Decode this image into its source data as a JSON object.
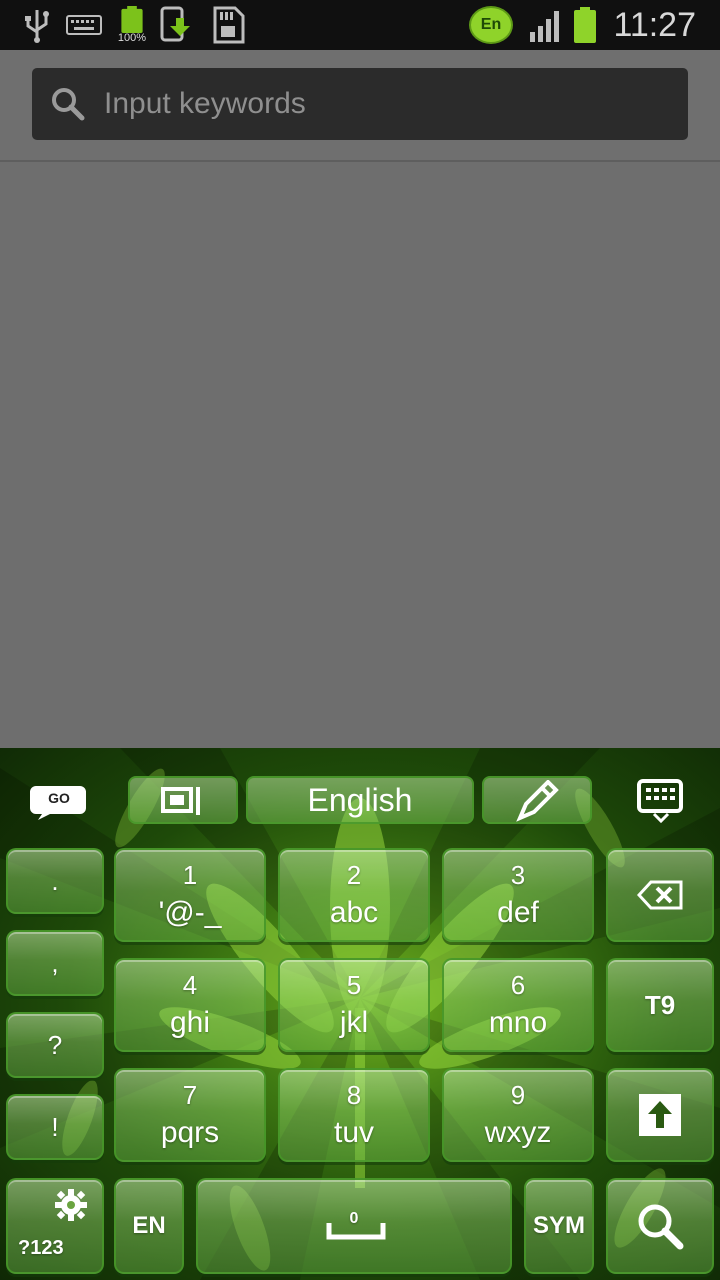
{
  "status_bar": {
    "battery_percent_label": "100%",
    "language_badge": "En",
    "time": "11:27",
    "icons": [
      "usb-icon",
      "keyboard-notification-icon",
      "battery-full-icon",
      "download-update-icon",
      "sd-card-icon",
      "language-badge-icon",
      "signal-icon",
      "battery-icon"
    ]
  },
  "search": {
    "placeholder": "Input keywords",
    "icon": "search-icon"
  },
  "keyboard": {
    "theme_colors": {
      "key_fill": "#a8dc80",
      "key_border": "#4a9628",
      "background": "#2a5a0e"
    },
    "toolbar": {
      "go_label": "GO",
      "language_label": "English",
      "icons": [
        "go-logo-icon",
        "resize-icon",
        "pen-icon",
        "keyboard-hide-icon"
      ]
    },
    "side_punct": [
      ".",
      ",",
      "?",
      "!"
    ],
    "keys": [
      {
        "num": "1",
        "letters": "'@-_"
      },
      {
        "num": "2",
        "letters": "abc"
      },
      {
        "num": "3",
        "letters": "def"
      },
      {
        "num": "4",
        "letters": "ghi"
      },
      {
        "num": "5",
        "letters": "jkl"
      },
      {
        "num": "6",
        "letters": "mno"
      },
      {
        "num": "7",
        "letters": "pqrs"
      },
      {
        "num": "8",
        "letters": "tuv"
      },
      {
        "num": "9",
        "letters": "wxyz"
      }
    ],
    "right_keys": {
      "t9_label": "T9",
      "icons": [
        "backspace-icon",
        "shift-arrow-icon"
      ]
    },
    "bottom_row": {
      "symbols_label": "?123",
      "lang_label": "EN",
      "space_label": "0",
      "sym_label": "SYM",
      "icons": [
        "gear-icon",
        "space-icon",
        "search-key-icon"
      ]
    }
  }
}
